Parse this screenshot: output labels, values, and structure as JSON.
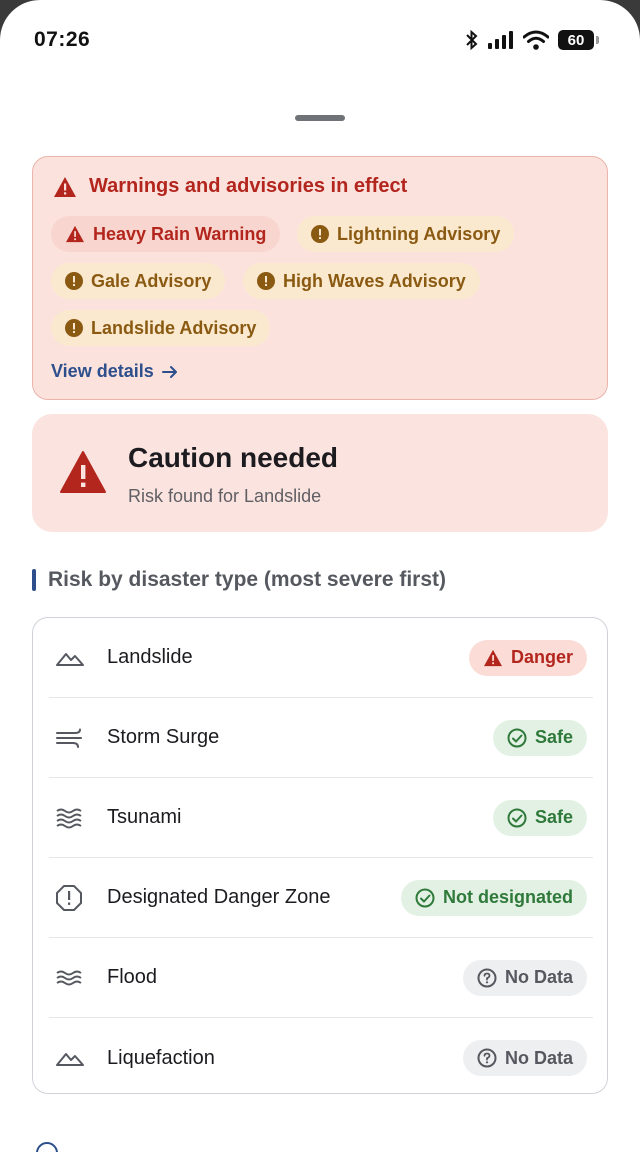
{
  "status_bar": {
    "time": "07:26",
    "battery": "60",
    "icons": [
      "bluetooth-icon",
      "signal-icon",
      "wifi-icon",
      "battery-icon"
    ]
  },
  "warnings": {
    "title": "Warnings and advisories in effect",
    "chips": [
      {
        "label": "Heavy Rain Warning",
        "level": "warning"
      },
      {
        "label": "Lightning Advisory",
        "level": "advisory"
      },
      {
        "label": "Gale Advisory",
        "level": "advisory"
      },
      {
        "label": "High Waves Advisory",
        "level": "advisory"
      },
      {
        "label": "Landslide Advisory",
        "level": "advisory"
      }
    ],
    "view_details": "View details"
  },
  "caution": {
    "title": "Caution needed",
    "subtitle": "Risk found for Landslide"
  },
  "section": {
    "title": "Risk by disaster type (most severe first)"
  },
  "risks": [
    {
      "label": "Landslide",
      "status": "Danger",
      "icon": "mountain-icon"
    },
    {
      "label": "Storm Surge",
      "status": "Safe",
      "icon": "wind-icon"
    },
    {
      "label": "Tsunami",
      "status": "Safe",
      "icon": "waves-icon"
    },
    {
      "label": "Designated Danger Zone",
      "status": "Not designated",
      "icon": "octagon-alert-icon"
    },
    {
      "label": "Flood",
      "status": "No Data",
      "icon": "flood-icon"
    },
    {
      "label": "Liquefaction",
      "status": "No Data",
      "icon": "mountain-icon"
    }
  ],
  "colors": {
    "danger": "#b3261e",
    "advisory": "#8a5a12",
    "safe": "#2f7a3a",
    "link": "#2d4f8c",
    "warn_bg": "#fbe2dd"
  }
}
